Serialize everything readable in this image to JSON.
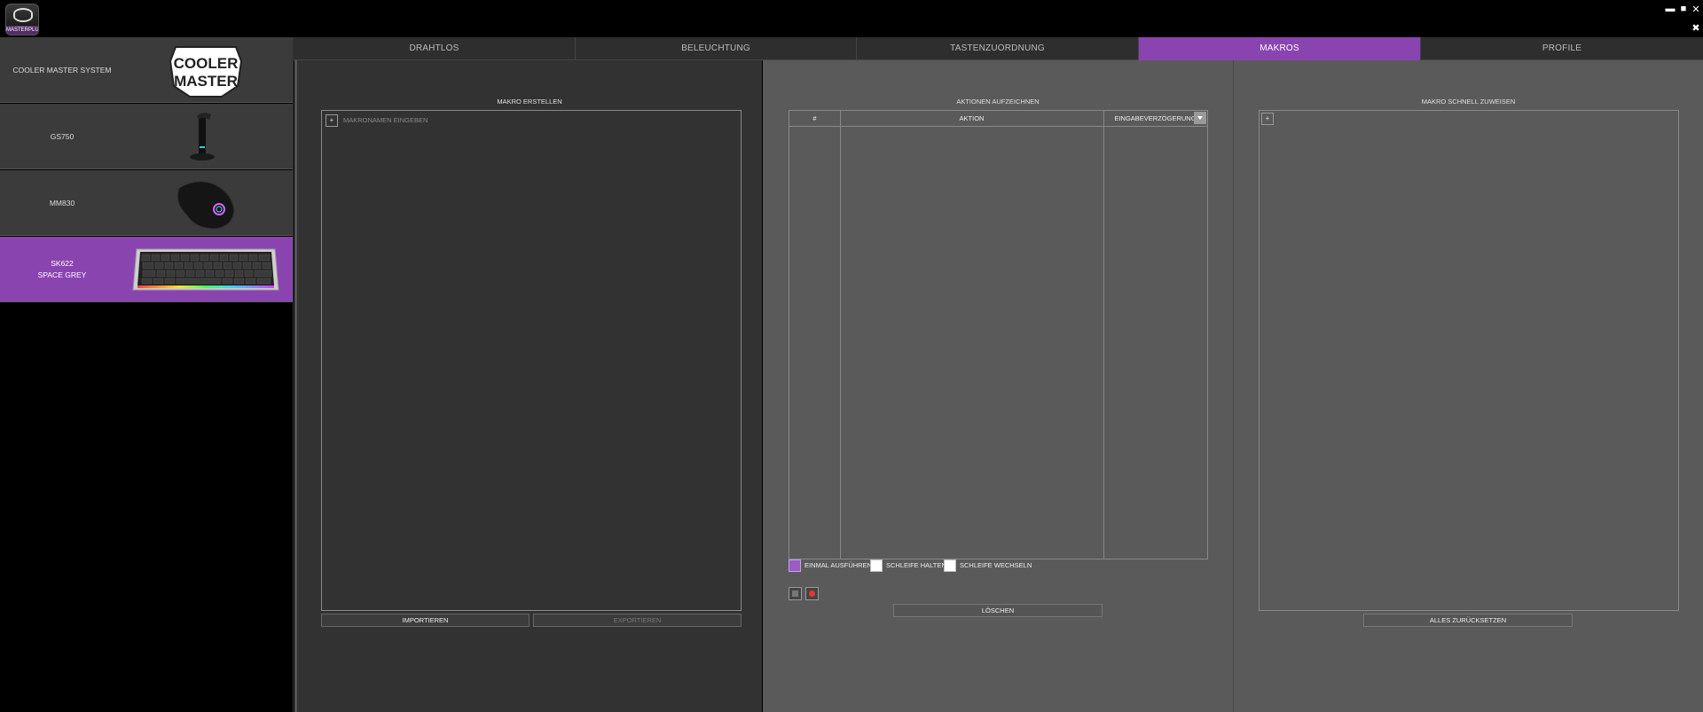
{
  "app": {
    "logo_text": "MASTERPLUS+"
  },
  "window_controls": {
    "minimize": "▬",
    "maximize": "■",
    "close": "✕",
    "settings": "✖"
  },
  "sidebar": {
    "items": [
      {
        "label": "COOLER MASTER SYSTEM",
        "label2": "",
        "image": "cooler-master-logo",
        "selected": false
      },
      {
        "label": "GS750",
        "label2": "",
        "image": "headset-stand",
        "selected": false
      },
      {
        "label": "MM830",
        "label2": "",
        "image": "gaming-mouse",
        "selected": false
      },
      {
        "label": "SK622",
        "label2": "SPACE GREY",
        "image": "keyboard",
        "selected": true
      }
    ],
    "logo_line1": "COOLER",
    "logo_line2": "MASTER"
  },
  "tabs": [
    {
      "label": "DRAHTLOS",
      "active": false
    },
    {
      "label": "BELEUCHTUNG",
      "active": false
    },
    {
      "label": "TASTENZUORDNUNG",
      "active": false
    },
    {
      "label": "MAKROS",
      "active": true
    },
    {
      "label": "PROFILE",
      "active": false
    }
  ],
  "create_macro": {
    "title": "MAKRO ERSTELLEN",
    "add_label": "+",
    "name_placeholder": "MAKRONAMEN EINGEBEN",
    "import_label": "IMPORTIEREN",
    "export_label": "EXPORTIEREN"
  },
  "record_actions": {
    "title": "AKTIONEN AUFZEICHNEN",
    "columns": [
      "#",
      "AKTION",
      "EINGABEVERZÖGERUNG"
    ],
    "dropdown_icon": "chevron-down-icon",
    "options": [
      {
        "label": "EINMAL AUSFÜHREN",
        "checked": true
      },
      {
        "label": "SCHLEIFE HALTEN",
        "checked": false
      },
      {
        "label": "SCHLEIFE WECHSELN",
        "checked": false
      }
    ],
    "delete_label": "LÖSCHEN"
  },
  "quick_assign": {
    "title": "MAKRO SCHNELL ZUWEISEN",
    "add_label": "+",
    "reset_label": "ALLES ZURÜCKSETZEN"
  },
  "colors": {
    "accent": "#8a44b0",
    "panel_dark": "#323232",
    "panel_mid": "#5a5a5a"
  }
}
